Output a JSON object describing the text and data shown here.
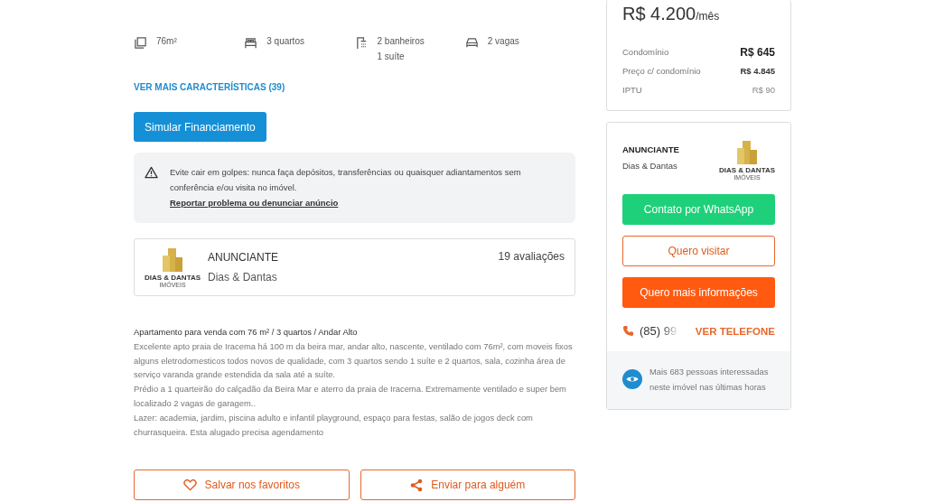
{
  "features": [
    {
      "kind": "area",
      "lines": [
        "76m²"
      ]
    },
    {
      "kind": "bed",
      "lines": [
        "3 quartos"
      ]
    },
    {
      "kind": "shower",
      "lines": [
        "2 banheiros",
        "1 suíte"
      ]
    },
    {
      "kind": "car",
      "lines": [
        "2 vagas"
      ]
    }
  ],
  "more_features_link": "VER MAIS CARACTERÍSTICAS (39)",
  "financing_button": "Simular Financiamento",
  "warning": {
    "text": "Evite cair em golpes: nunca faça depósitos, transferências ou quaisquer adiantamentos sem conferência e/ou visita no imóvel.",
    "link": "Reportar problema ou denunciar anúncio"
  },
  "advertiser_card": {
    "label": "ANUNCIANTE",
    "name": "Dias & Dantas",
    "reviews": "19 avaliações",
    "logo": {
      "name": "DIAS & DANTAS",
      "sub": "IMÓVEIS"
    }
  },
  "description": {
    "title": "Apartamento para venda com 76 m² / 3 quartos / Andar Alto",
    "paragraphs": [
      "Excelente apto praia de Iracema há 100 m da beira mar, andar alto, nascente, ventilado com 76m², com moveis fixos alguns eletrodomesticos todos novos de qualidade, com 3 quartos sendo 1 suíte e 2 quartos, sala, cozinha área de serviço varanda grande estendida da sala até a suíte.",
      "Prédio a 1 quarteirão do calçadão da Beira Mar e aterro da praia de Iracema. Extremamente ventilado e super bem localizado 2 vagas de garagem..",
      "Lazer: academia, jardim, piscina adulto e infantil playground, espaço para festas, salão de jogos deck com churrasqueira. Esta alugado precisa agendamento"
    ]
  },
  "actions": [
    {
      "kind": "favorite",
      "label": "Salvar nos favoritos"
    },
    {
      "kind": "share",
      "label": "Enviar para alguém"
    }
  ],
  "price": {
    "amount": "R$ 4.200",
    "unit": "/mês",
    "rows": [
      {
        "label": "Condomínio",
        "value": "R$ 645",
        "kind": "strong"
      },
      {
        "label": "Preço c/ condomínio",
        "value": "R$ 4.845",
        "kind": "medium"
      },
      {
        "label": "IPTU",
        "value": "R$ 90",
        "kind": "light"
      }
    ]
  },
  "contact": {
    "label": "ANUNCIANTE",
    "name": "Dias & Dantas",
    "logo": {
      "name": "DIAS & DANTAS",
      "sub": "IMÓVEIS"
    },
    "buttons": [
      {
        "kind": "whatsapp",
        "label": "Contato por WhatsApp"
      },
      {
        "kind": "outline",
        "label": "Quero visitar"
      },
      {
        "kind": "filled",
        "label": "Quero mais informações"
      }
    ],
    "phone": "(85) 99",
    "phone_link": "VER TELEFONE",
    "interest": "Mais 683 pessoas interessadas neste imóvel nas últimas horas"
  }
}
